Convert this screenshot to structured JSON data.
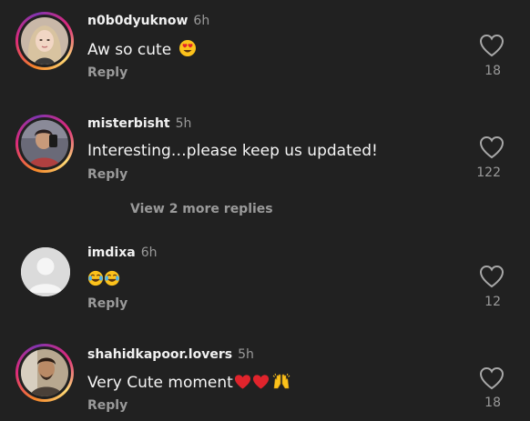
{
  "comments": [
    {
      "username": "n0b0dyuknow",
      "time": "6h",
      "text": "Aw so cute",
      "emoji": "heart-eyes",
      "reply": "Reply",
      "likes": "18"
    },
    {
      "username": "misterbisht",
      "time": "5h",
      "text": "Interesting…please keep us updated!",
      "reply": "Reply",
      "likes": "122"
    },
    {
      "username": "imdixa",
      "time": "6h",
      "text": "",
      "emoji": "tears-of-joy x2",
      "reply": "Reply",
      "likes": "12"
    },
    {
      "username": "shahidkapoor.lovers",
      "time": "5h",
      "text": "Very Cute moment",
      "emoji": "red-heart x2, raising-hands",
      "reply": "Reply",
      "likes": "18"
    }
  ],
  "view_more": "View 2 more replies",
  "colors": {
    "background": "#212121",
    "secondary_text": "#9a9a9a",
    "heart_emoji": "#e0242c",
    "story_ring_start": "#f58529",
    "story_ring_mid": "#dd2a7b",
    "story_ring_end": "#8134af"
  }
}
